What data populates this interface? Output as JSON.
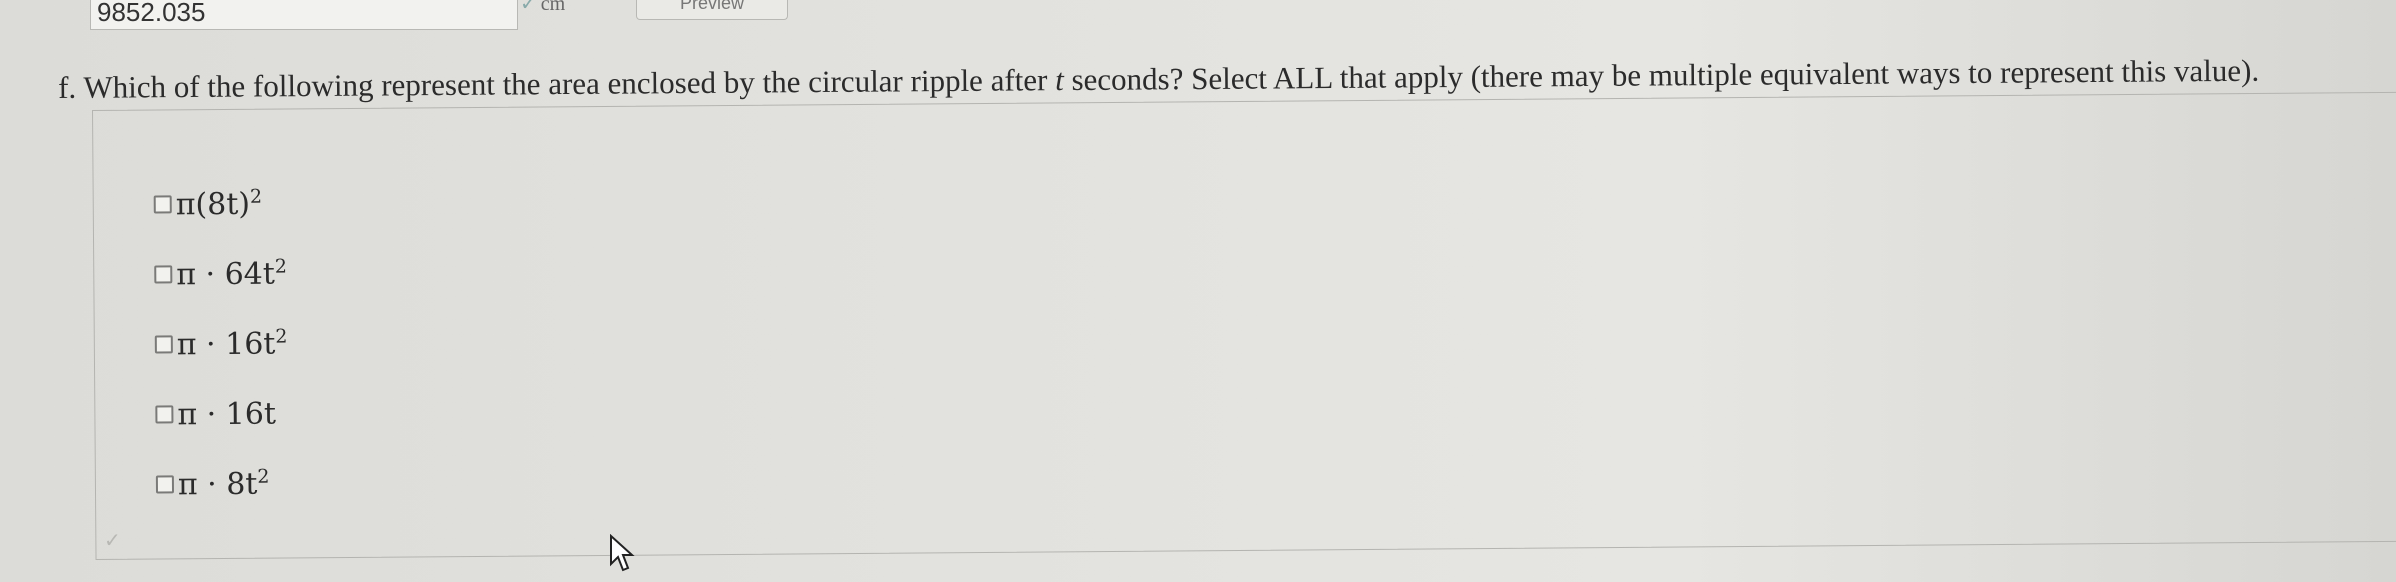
{
  "previous_answer": {
    "value": "9852.035",
    "unit_label": "cm",
    "preview_label": "Preview"
  },
  "question": {
    "prefix": "f. Which of the following represent the area enclosed by the circular ripple after ",
    "variable": "t",
    "suffix": " seconds? Select ALL that apply (there may be multiple equivalent ways to represent this value)."
  },
  "options": [
    {
      "main": "π(8t)",
      "sup": "2",
      "checked": false
    },
    {
      "main": "π · 64t",
      "sup": "2",
      "checked": false
    },
    {
      "main": "π · 16t",
      "sup": "2",
      "checked": false
    },
    {
      "main": "π · 16t",
      "sup": "",
      "checked": false
    },
    {
      "main": "π · 8t",
      "sup": "2",
      "checked": false
    }
  ],
  "icons": {
    "unit_check": "check-icon",
    "answer_check": "check-icon",
    "cursor": "mouse-pointer-icon"
  }
}
